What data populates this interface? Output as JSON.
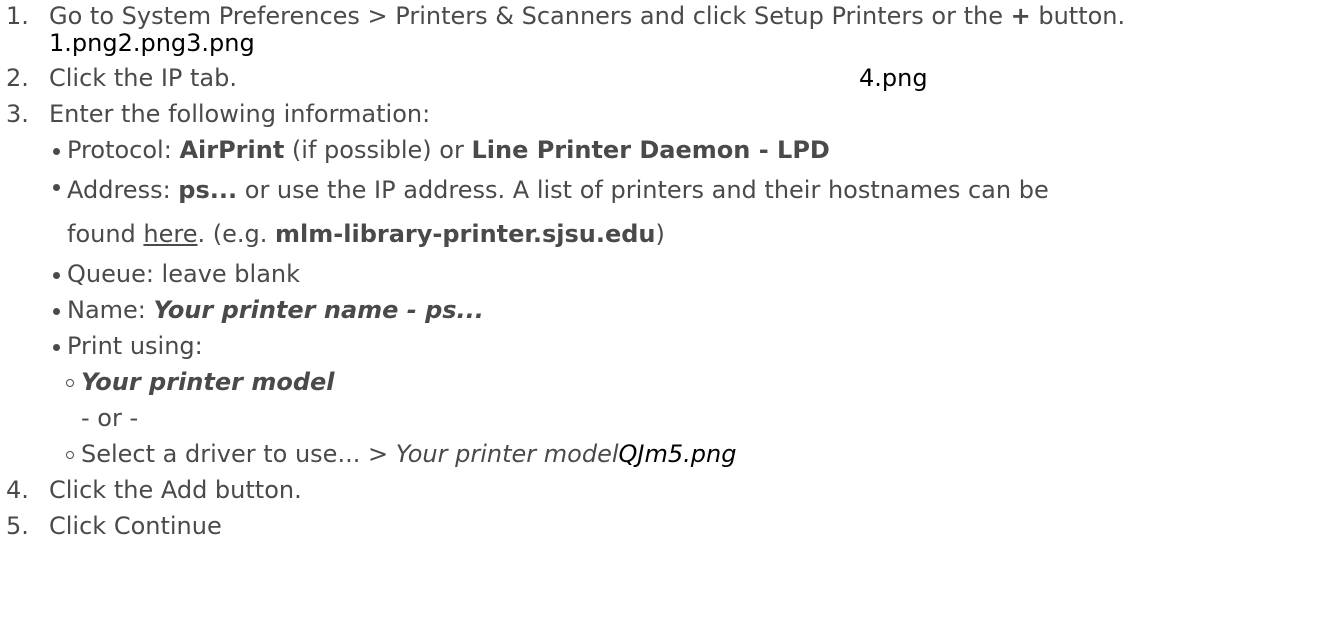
{
  "steps": [
    {
      "number": "1.",
      "text_a": "Go to System Preferences > Printers & Scanners and click Setup Printers or the ",
      "plus": "+",
      "text_b": " button.",
      "images": "1.png2.png3.png"
    },
    {
      "number": "2.",
      "text": "Click the IP tab.",
      "image": "4.png"
    },
    {
      "number": "3.",
      "text": "Enter the following information:",
      "protocol": {
        "label": "Protocol: ",
        "value1": "AirPrint",
        "mid": " (if possible) or ",
        "value2": "Line Printer Daemon - LPD"
      },
      "address": {
        "label": "Address: ",
        "value": "ps...",
        "text1": " or use the IP address. A list of printers and their hostnames can be",
        "text2": "found ",
        "link": "here",
        "text3": ". (e.g. ",
        "example": "mlm-library-printer.sjsu.edu",
        "text4": ")"
      },
      "queue": "Queue: leave blank",
      "name": {
        "label": "Name: ",
        "value": "Your printer name - ps..."
      },
      "print_using": {
        "label": "Print using:",
        "option1": "Your printer model",
        "or_text": "- or -",
        "option2_text": "Select a driver to use... > ",
        "option2_italic": "Your printer model",
        "option2_image": "QJm5.png"
      }
    },
    {
      "number": "4.",
      "text": "Click the Add button."
    },
    {
      "number": "5.",
      "text": "Click Continue"
    }
  ]
}
